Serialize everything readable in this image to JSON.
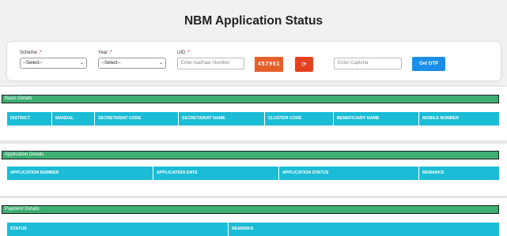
{
  "page": {
    "title": "NBM Application Status"
  },
  "filters": {
    "scheme": {
      "label": "Scheme :",
      "required_mark": "*",
      "value": "--Select--"
    },
    "year": {
      "label": "Year :",
      "required_mark": "*",
      "value": "--Select--"
    },
    "uid": {
      "label": "UID :",
      "required_mark": "*",
      "placeholder": "Enter Aadhaar Number"
    },
    "captcha_code": "457961",
    "refresh_symbol": "⟳",
    "captcha_input": {
      "placeholder": "Enter Captcha"
    },
    "get_otp_label": "Get OTP"
  },
  "basic_details": {
    "header": "Basic Details",
    "columns": [
      "DISTRICT",
      "MANDAL",
      "SECRETARIAT CODE",
      "SECRETARIAT NAME",
      "CLUSTER CODE",
      "BENEFICIARY NAME",
      "MOBILE NUMBER"
    ]
  },
  "application_details": {
    "header": "Application Details",
    "columns": [
      "APPLICATION NUMBER",
      "APPLICATION DATE",
      "APPLICATION STATUS",
      "REMARKS"
    ]
  },
  "payment_details": {
    "header": "Payment Details",
    "columns": [
      "STATUS",
      "REMARKS"
    ]
  },
  "colors": {
    "section_header": "#3daf72",
    "table_header": "#1bbcd5",
    "captcha_bg": "#e4602a",
    "refresh_button": "#e4421f",
    "otp_button": "#1a8ee8"
  }
}
